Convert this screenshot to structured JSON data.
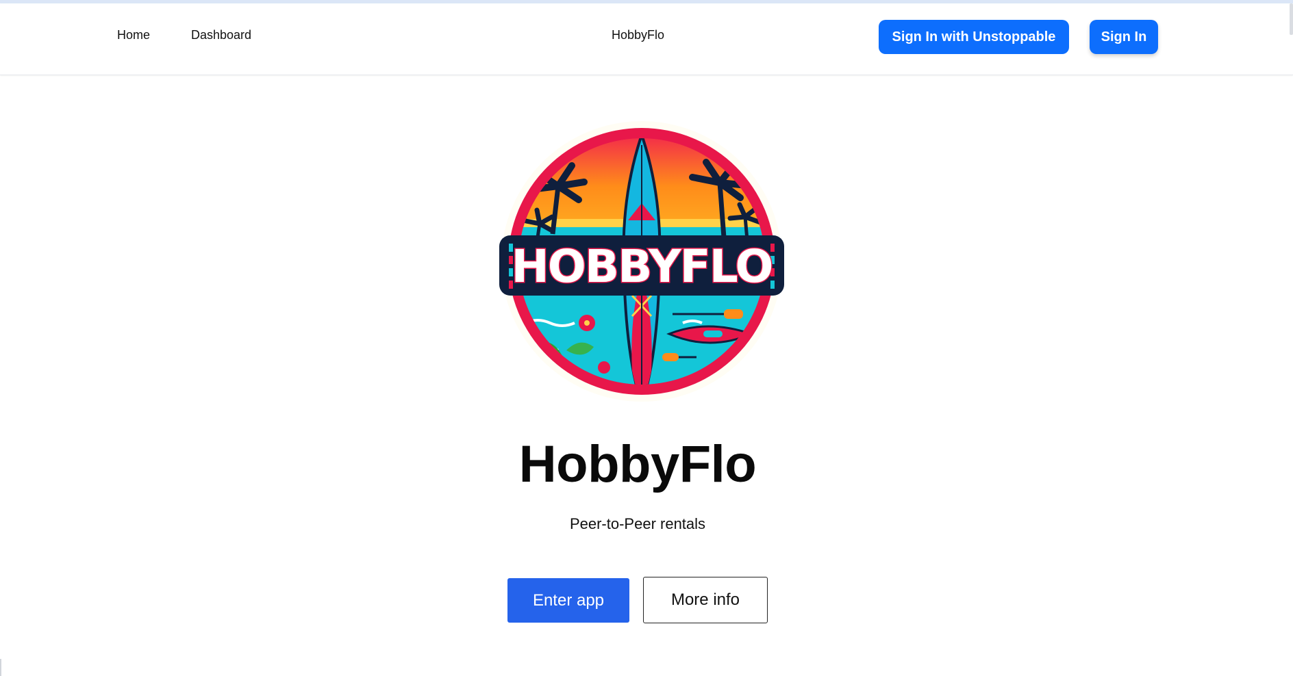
{
  "navbar": {
    "home_label": "Home",
    "dashboard_label": "Dashboard",
    "brand_label": "HobbyFlo",
    "unstoppable_button_label": "Sign In with Unstoppable",
    "signin_button_label": "Sign In"
  },
  "logo": {
    "text": "HOBBYFLO",
    "icon_name": "hobbyflo-logo-icon"
  },
  "hero": {
    "title": "HobbyFlo",
    "subtitle": "Peer-to-Peer rentals",
    "enter_button_label": "Enter app",
    "more_button_label": "More info"
  },
  "colors": {
    "primary_button": "#0d6efd",
    "enter_button": "#2563eb",
    "logo_ring": "#e8174a",
    "logo_navy": "#0f1f3d",
    "logo_water": "#14c6d8"
  }
}
